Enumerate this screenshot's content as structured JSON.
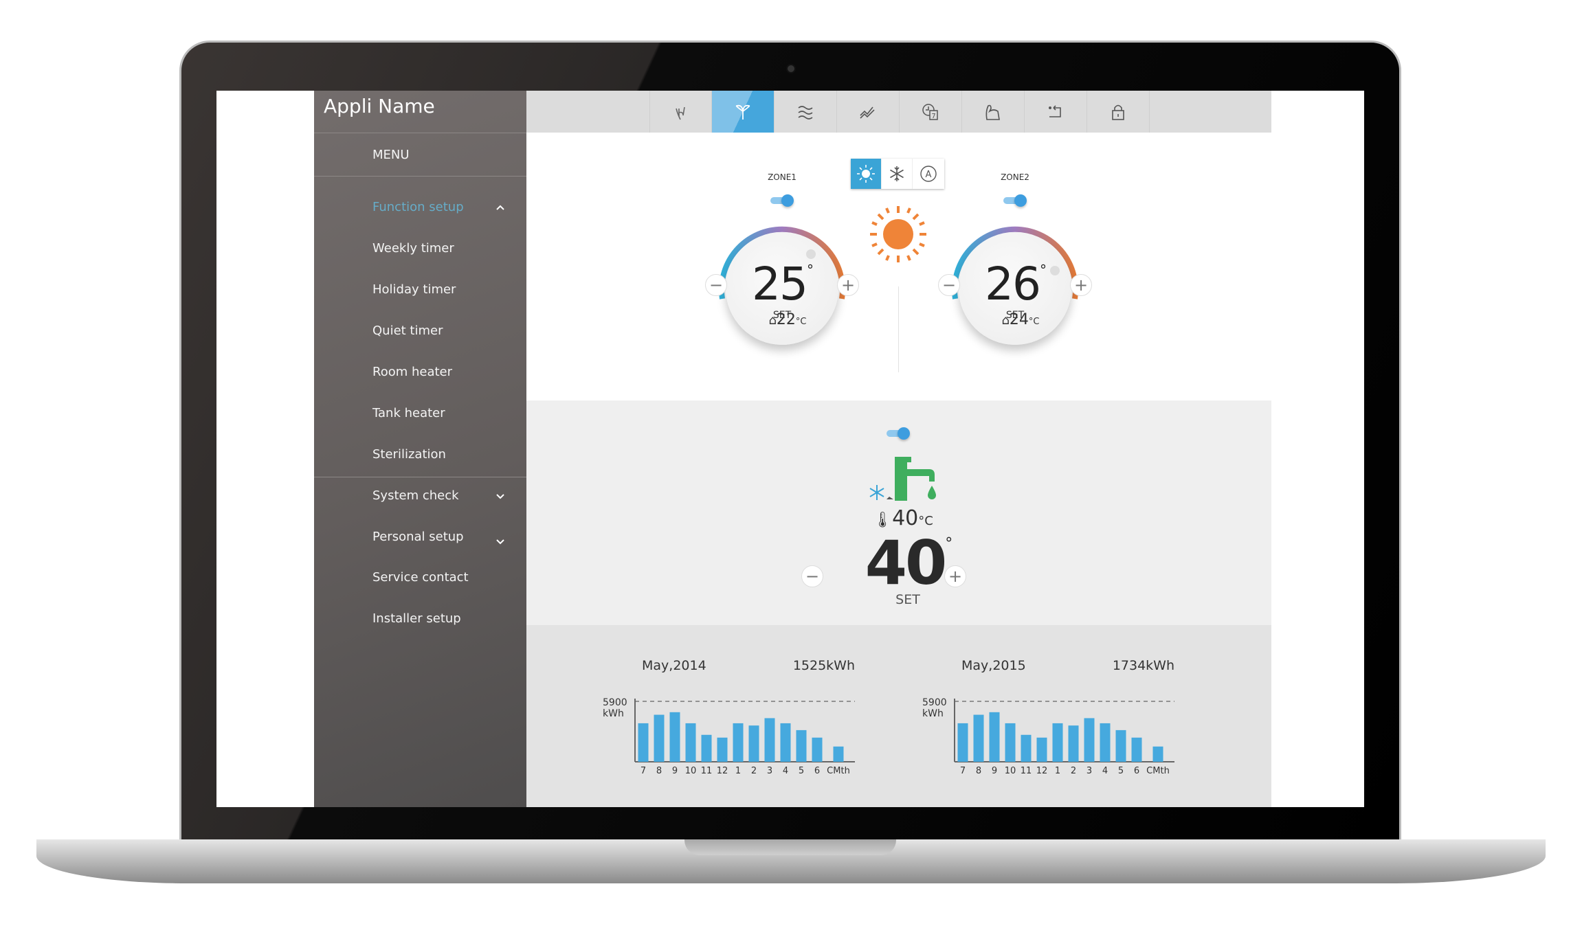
{
  "app": {
    "title": "Appli Name"
  },
  "sidebar": {
    "menu_label": "MENU",
    "items": [
      {
        "label": "Function setup",
        "active": true,
        "chevron": "chevron-up"
      },
      {
        "label": "Weekly timer"
      },
      {
        "label": "Holiday timer"
      },
      {
        "label": "Quiet timer"
      },
      {
        "label": "Room heater"
      },
      {
        "label": "Tank heater"
      },
      {
        "label": "Sterilization"
      },
      {
        "label": "System check",
        "chevron": "chevron-down"
      },
      {
        "label": "Personal setup",
        "chevron": "chevron-down"
      },
      {
        "label": "Service contact"
      },
      {
        "label": "Installer setup"
      }
    ]
  },
  "topbar": {
    "tabs": [
      {
        "icon": "touch-hand-icon"
      },
      {
        "icon": "sprout-eco-icon",
        "active": true
      },
      {
        "icon": "air-flow-icon"
      },
      {
        "icon": "energy-graph-icon"
      },
      {
        "icon": "weekly-timer-icon",
        "text": "7"
      },
      {
        "icon": "power-boost-icon"
      },
      {
        "icon": "return-icon"
      },
      {
        "icon": "lock-icon"
      }
    ]
  },
  "modes": [
    {
      "icon": "sun-heat-icon",
      "active": true
    },
    {
      "icon": "snowflake-cool-icon"
    },
    {
      "icon": "auto-mode-icon",
      "text": "A"
    }
  ],
  "zones": [
    {
      "label": "ZONE1",
      "enabled": true,
      "set_temp": "25",
      "set_label": "SET",
      "room_temp": "22",
      "unit": "°C"
    },
    {
      "label": "ZONE2",
      "enabled": true,
      "set_temp": "26",
      "set_label": "SET",
      "room_temp": "24",
      "unit": "°C"
    }
  ],
  "water": {
    "enabled": true,
    "current_temp": "40",
    "unit": "°C",
    "set_temp": "40",
    "set_label": "SET"
  },
  "colors": {
    "accent": "#3d9ddf",
    "bar": "#46a9de",
    "faucet": "#3fae5e",
    "sun": "#ef8438",
    "menu_active": "#66acc8"
  },
  "chart_data": [
    {
      "type": "bar",
      "title": "May,2014",
      "total": "1525kWh",
      "ymax_label": "5900",
      "yunit": "kWh",
      "ylim": [
        0,
        5900
      ],
      "categories": [
        "7",
        "8",
        "9",
        "10",
        "11",
        "12",
        "1",
        "2",
        "3",
        "4",
        "5",
        "6",
        "CMth"
      ],
      "values": [
        3760,
        4590,
        4840,
        3760,
        2630,
        2360,
        3760,
        3540,
        4260,
        3760,
        3090,
        2360,
        1490
      ]
    },
    {
      "type": "bar",
      "title": "May,2015",
      "total": "1734kWh",
      "ymax_label": "5900",
      "yunit": "kWh",
      "ylim": [
        0,
        5900
      ],
      "categories": [
        "7",
        "8",
        "9",
        "10",
        "11",
        "12",
        "1",
        "2",
        "3",
        "4",
        "5",
        "6",
        "CMth"
      ],
      "values": [
        3760,
        4590,
        4840,
        3760,
        2630,
        2360,
        3760,
        3540,
        4260,
        3760,
        3090,
        2360,
        1490
      ]
    }
  ]
}
